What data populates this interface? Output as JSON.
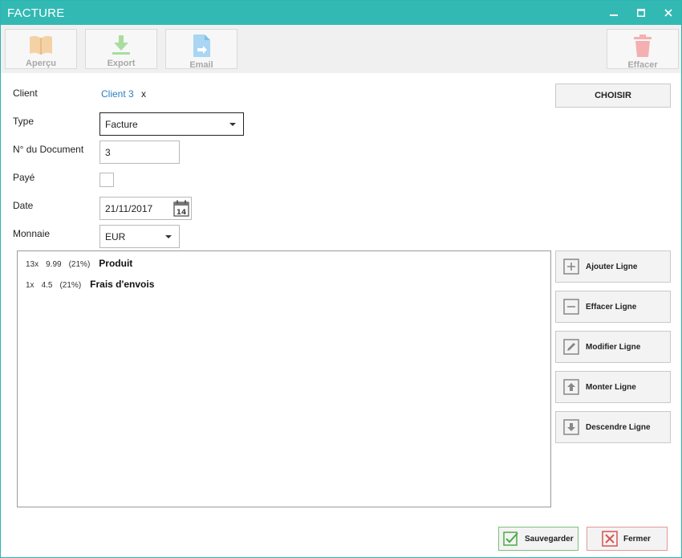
{
  "window": {
    "title": "FACTURE"
  },
  "toolbar": {
    "preview_label": "Aperçu",
    "export_label": "Export",
    "email_label": "Email",
    "delete_label": "Effacer"
  },
  "form": {
    "client_label": "Client",
    "client_value": "Client 3",
    "client_clear": "x",
    "choose_label": "CHOISIR",
    "type_label": "Type",
    "type_value": "Facture",
    "docnum_label": "N° du Document",
    "docnum_value": "3",
    "paid_label": "Payé",
    "paid_checked": false,
    "date_label": "Date",
    "date_value": "21/11/2017",
    "currency_label": "Monnaie",
    "currency_value": "EUR"
  },
  "lines": [
    {
      "qty": "13x",
      "price": "9.99",
      "tax": "(21%)",
      "name": "Produit"
    },
    {
      "qty": "1x",
      "price": "4.5",
      "tax": "(21%)",
      "name": "Frais d'envois"
    }
  ],
  "line_actions": {
    "add": "Ajouter Ligne",
    "remove": "Effacer Ligne",
    "edit": "Modifier Ligne",
    "up": "Monter Ligne",
    "down": "Descendre Ligne"
  },
  "footer": {
    "save_label": "Sauvegarder",
    "close_label": "Fermer"
  },
  "colors": {
    "titlebar": "#33b9b3",
    "link": "#2a7ec0",
    "save_border": "#7dc27a",
    "close_border": "#e59a9a"
  }
}
